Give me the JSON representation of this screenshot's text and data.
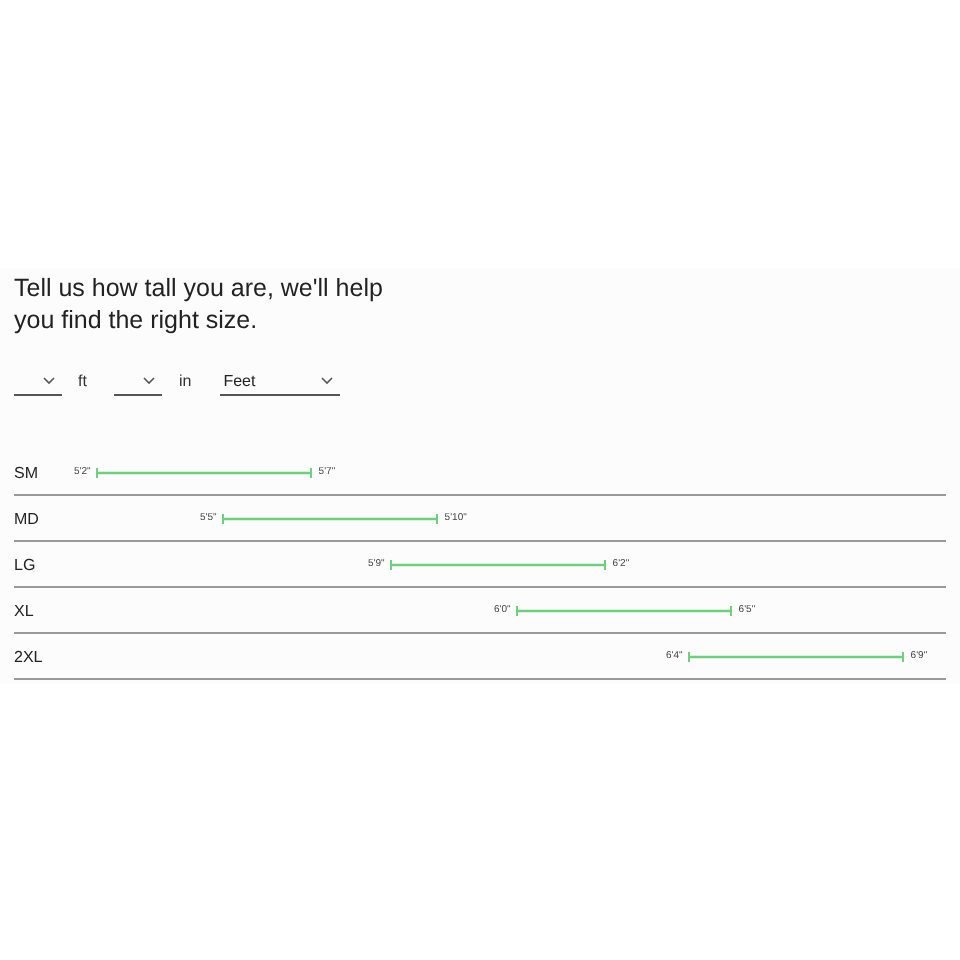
{
  "heading": "Tell us how tall you are, we'll help you find the right size.",
  "height_inputs": [
    {
      "kind": "select",
      "unit": "ft"
    },
    {
      "kind": "select",
      "unit": "in"
    },
    {
      "kind": "wide_select",
      "value": "Feet"
    }
  ],
  "sizes": [
    {
      "size": "SM",
      "min": "5'2\"",
      "max": "5'7\""
    },
    {
      "size": "MD",
      "min": "5'5\"",
      "max": "5'10\""
    },
    {
      "size": "LG",
      "min": "5'9\"",
      "max": "6'2\""
    },
    {
      "size": "XL",
      "min": "6'0\"",
      "max": "6'5\""
    },
    {
      "size": "2XL",
      "min": "6'4\"",
      "max": "6'9\""
    }
  ]
}
